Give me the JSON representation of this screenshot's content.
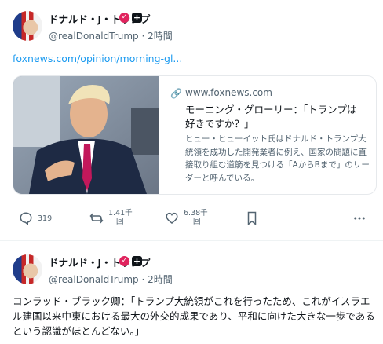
{
  "posts": [
    {
      "author_name": "ドナルド・J・トランプ",
      "handle": "@realDonaldTrump",
      "time": "2時間",
      "link_text": "foxnews.com/opinion/morning-gl...",
      "card": {
        "domain": "www.foxnews.com",
        "title": "モーニング・グローリー：「トランプは好きですか？」",
        "description": "ヒュー・ヒューイット氏はドナルド・トランプ大統領を成功した開発業者に例え、国家の問題に直接取り組む道筋を見つける「AからBまで」のリーダーと呼んでいる。"
      },
      "actions": {
        "replies": "319",
        "reposts_line1": "1.41千",
        "reposts_line2": "回",
        "likes_line1": "6.38千",
        "likes_line2": "回"
      }
    },
    {
      "author_name": "ドナルド・J・トランプ",
      "handle": "@realDonaldTrump",
      "time": "2時間",
      "text": "コンラッド・ブラック卿：「トランプ大統領がこれを行ったため、これがイスラエル建国以来中東における最大の外交的成果であり、平和に向けた大きな一歩であるという認識がほとんどない。」"
    }
  ],
  "icons": {
    "verified": "verified-check-icon",
    "org": "plus-badge-icon",
    "reply": "reply-icon",
    "repost": "repost-icon",
    "like": "heart-icon",
    "bookmark": "bookmark-icon",
    "more": "more-icon",
    "link": "link-icon"
  }
}
